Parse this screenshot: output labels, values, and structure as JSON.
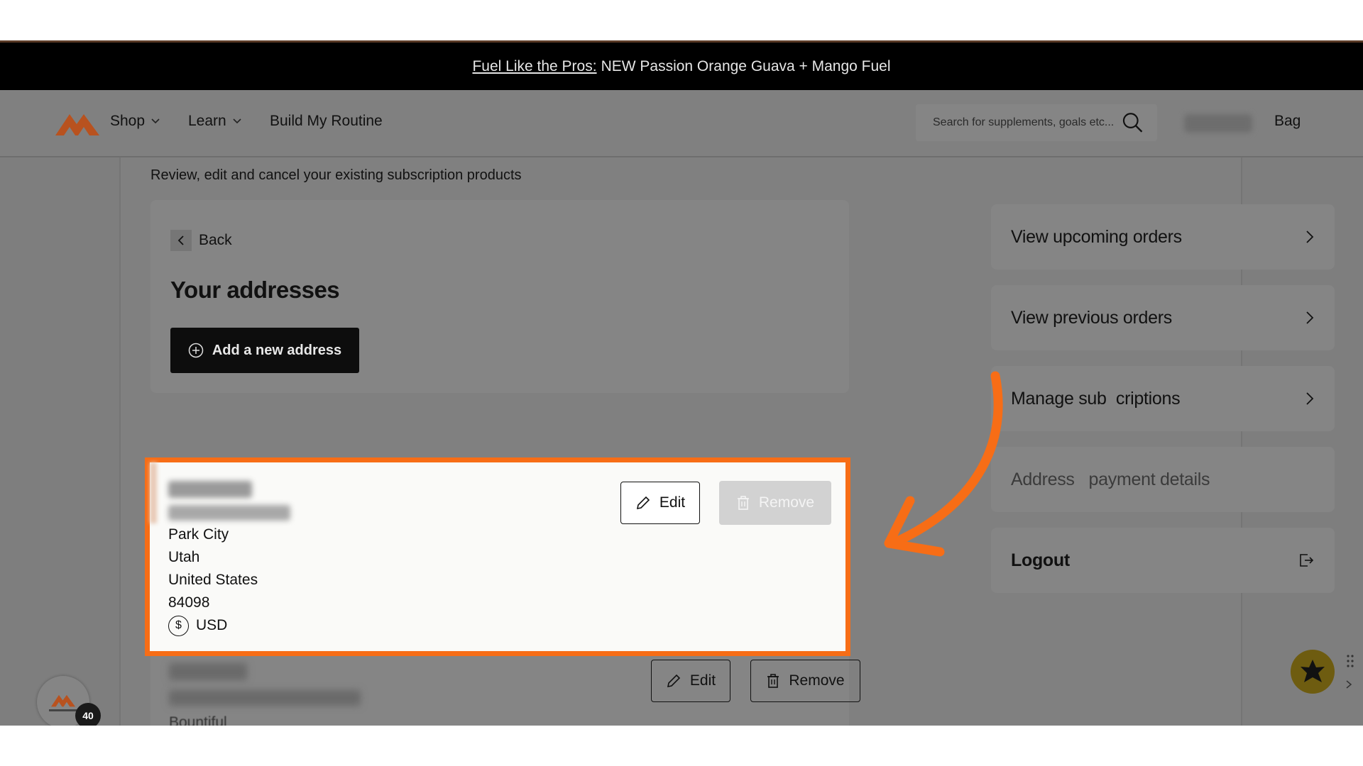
{
  "promo": {
    "link": "Fuel Like the Pros:",
    "text": "NEW Passion Orange Guava + Mango Fuel"
  },
  "nav": {
    "shop": "Shop",
    "learn": "Learn",
    "build": "Build My Routine",
    "search_placeholder": "Search for supplements, goals etc...",
    "bag": "Bag"
  },
  "page": {
    "subtitle": "Review, edit and cancel your existing subscription products"
  },
  "addresses_panel": {
    "back": "Back",
    "title": "Your addresses",
    "add_button": "Add a new address"
  },
  "address_card_1": {
    "city": "Park City",
    "state": "Utah",
    "country": "United States",
    "zip": "84098",
    "currency_symbol": "$",
    "currency": "USD",
    "edit": "Edit",
    "remove": "Remove"
  },
  "address_card_2": {
    "partial_text": "Bountiful",
    "edit": "Edit",
    "remove": "Remove"
  },
  "account_menu": {
    "items": [
      {
        "label": "View upcoming orders"
      },
      {
        "label": "View previous orders"
      },
      {
        "label": "Manage sub  criptions"
      },
      {
        "label": "Address   payment details"
      },
      {
        "label": "Logout"
      }
    ]
  },
  "widget": {
    "badge_count": "40"
  },
  "colors": {
    "highlight": "#f76d16",
    "brand": "#b8521f"
  }
}
